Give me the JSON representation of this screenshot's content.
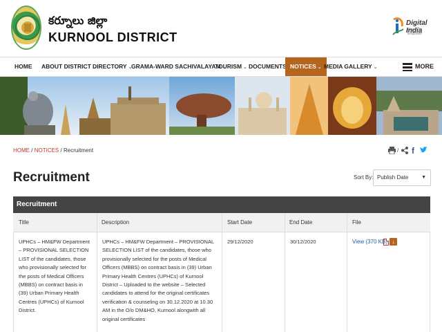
{
  "header": {
    "title_telugu": "కర్నూలు జిల్లా",
    "title_english": "KURNOOL DISTRICT",
    "digital_india": "Digital India",
    "digital_india_tagline": "Power To Empower"
  },
  "nav": {
    "items": [
      {
        "label": "HOME",
        "chevron": false
      },
      {
        "label": "ABOUT DISTRICT",
        "chevron": true
      },
      {
        "label": "DIRECTORY",
        "chevron": true
      },
      {
        "label": "GRAMA-WARD SACHIVALAYAM",
        "chevron": true
      },
      {
        "label": "TOURISM",
        "chevron": true
      },
      {
        "label": "DOCUMENTS",
        "chevron": true
      },
      {
        "label": "NOTICES",
        "chevron": true,
        "active": true
      },
      {
        "label": "MEDIA GALLERY",
        "chevron": true
      }
    ],
    "more_label": "MORE",
    "active_color": "#b5651d"
  },
  "breadcrumb": {
    "home": "HOME",
    "sep": "/",
    "notices": "NOTICES",
    "current": "Recruitment"
  },
  "share": {
    "sep": "/"
  },
  "page": {
    "title": "Recruitment",
    "sort_label": "Sort By:",
    "sort_value": "Publish Date"
  },
  "table": {
    "caption": "Recruitment",
    "columns": [
      "Title",
      "Description",
      "Start Date",
      "End Date",
      "File"
    ],
    "rows": [
      {
        "title": "UPHCs – HM&FW Department – PROVISIONAL SELECTION LIST of the candidates, those who provisionally selected for the posts of Medical Officers (MBBS) on contract basis in (39) Urban Primary Health Centres (UPHCs) of Kurnool District.",
        "description": "UPHCs – HM&FW Department – PROVISIONAL SELECTION LIST of the candidates, those who provisionally selected for the posts of Medical Officers (MBBS) on contract basis in (39) Urban Primary Health Centres (UPHCs) of Kurnool District – Uploaded to the website – Selected candidates to attend for the original certificates verification & counseling on 30.12.2020 at 10.30 AM in the O/o DM&HO, Kurnool alongwith all original certificates",
        "start_date": "29/12/2020",
        "end_date": "30/12/2020",
        "file_label": "View (370 KB)"
      }
    ]
  },
  "icons": {
    "print": "print-icon",
    "share": "share-icon",
    "facebook": "facebook-icon",
    "twitter": "twitter-icon",
    "pdf": "pdf-icon",
    "download": "download-icon"
  }
}
